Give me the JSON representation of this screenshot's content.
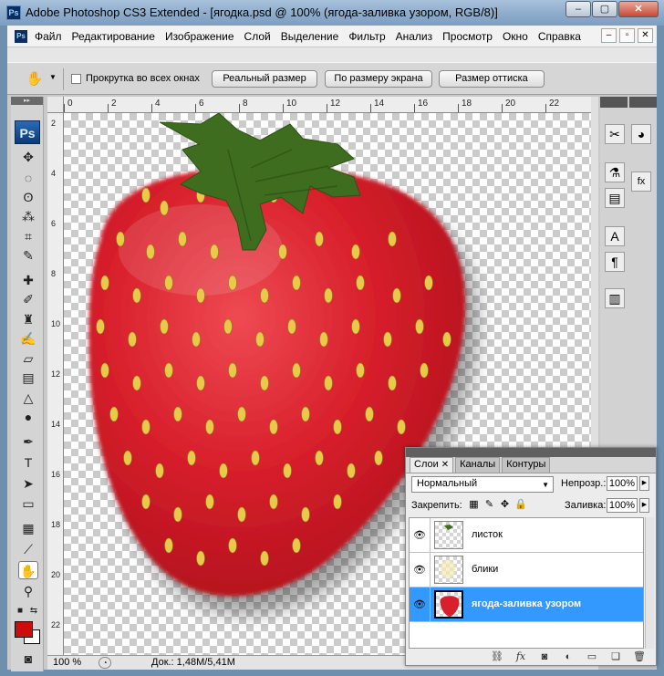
{
  "window": {
    "title": "Adobe Photoshop CS3 Extended - [ягодка.psd @ 100% (ягода-заливка узором, RGB/8)]",
    "app_icon_text": "Ps",
    "minimize": "–",
    "maximize": "▢",
    "close": "✕"
  },
  "menu": {
    "icon_text": "Ps",
    "items": [
      "Файл",
      "Редактирование",
      "Изображение",
      "Слой",
      "Выделение",
      "Фильтр",
      "Анализ",
      "Просмотр",
      "Окно",
      "Справка"
    ],
    "doc_minimize": "–",
    "doc_restore": "▫",
    "doc_close": "✕"
  },
  "options": {
    "tool_icon": "hand-icon",
    "tool_glyph": "✋",
    "dropdown_glyph": "▼",
    "scroll_all_label": "Прокрутка во всех окнах",
    "scroll_all_checked": false,
    "buttons": [
      "Реальный размер",
      "По размеру экрана",
      "Размер оттиска"
    ]
  },
  "toolbox": {
    "collapse": "▸▸",
    "logo": "Ps",
    "foreground_color": "#cc0d0d",
    "background_color": "#ffffff"
  },
  "rulers": {
    "top": [
      "0",
      "2",
      "4",
      "6",
      "8",
      "10",
      "12",
      "14",
      "16",
      "18",
      "20",
      "22"
    ],
    "left": [
      "2",
      "4",
      "6",
      "8",
      "10",
      "12",
      "14",
      "16",
      "18",
      "20",
      "22"
    ]
  },
  "status": {
    "zoom": "100 %",
    "doc_size": "Док.: 1,48M/5,41M"
  },
  "layers_panel": {
    "tabs": [
      {
        "label": "Слои",
        "active": true
      },
      {
        "label": "Каналы",
        "active": false
      },
      {
        "label": "Контуры",
        "active": false
      }
    ],
    "tab_close": "✕",
    "blend_mode": "Нормальный",
    "opacity_label": "Непрозр.:",
    "opacity_value": "100%",
    "lock_label": "Закрепить:",
    "fill_label": "Заливка:",
    "fill_value": "100%",
    "layers": [
      {
        "name": "листок",
        "visible": true,
        "selected": false
      },
      {
        "name": "блики",
        "visible": true,
        "selected": false
      },
      {
        "name": "ягода-заливка узором",
        "visible": true,
        "selected": true
      }
    ],
    "footer_icons": [
      "link-icon",
      "fx-icon",
      "mask-icon",
      "adjustment-icon",
      "group-icon",
      "new-layer-icon",
      "trash-icon"
    ]
  },
  "colors": {
    "selection": "#3399ff",
    "strawberry": "#d8202c",
    "leaf": "#3e6d1f",
    "seed": "#e8c94a"
  }
}
